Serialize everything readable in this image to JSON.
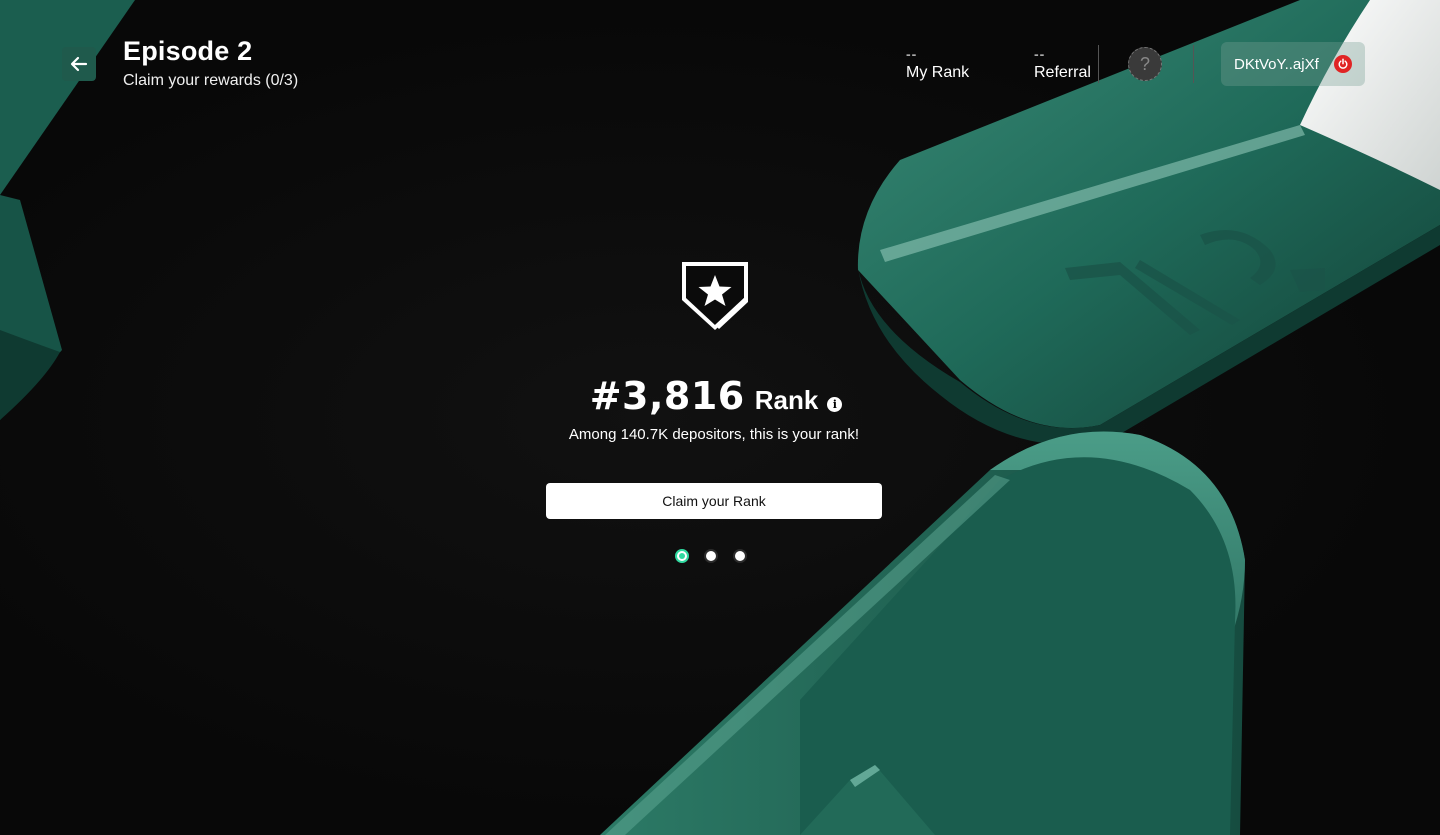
{
  "header": {
    "title": "Episode 2",
    "subtitle": "Claim your rewards (0/3)",
    "back_icon": "arrow-left-icon"
  },
  "stats": {
    "my_rank": {
      "value": "--",
      "label": "My Rank"
    },
    "referral": {
      "value": "--",
      "label": "Referral"
    }
  },
  "help": {
    "glyph": "?"
  },
  "wallet": {
    "address": "DKtVoY..ajXf",
    "disconnect_icon": "power-icon"
  },
  "rank_card": {
    "badge_icon": "shield-star-icon",
    "rank_number": "#3,816",
    "rank_word": "Rank",
    "info_glyph": "i",
    "description": "Among 140.7K depositors, this is your rank!",
    "claim_label": "Claim your Rank"
  },
  "pagination": {
    "total": 3,
    "active_index": 0
  },
  "colors": {
    "background": "#0b0b0b",
    "accent_green": "#1f5a4c",
    "active_dot": "#2fd9a0",
    "power_red": "#e02424"
  }
}
